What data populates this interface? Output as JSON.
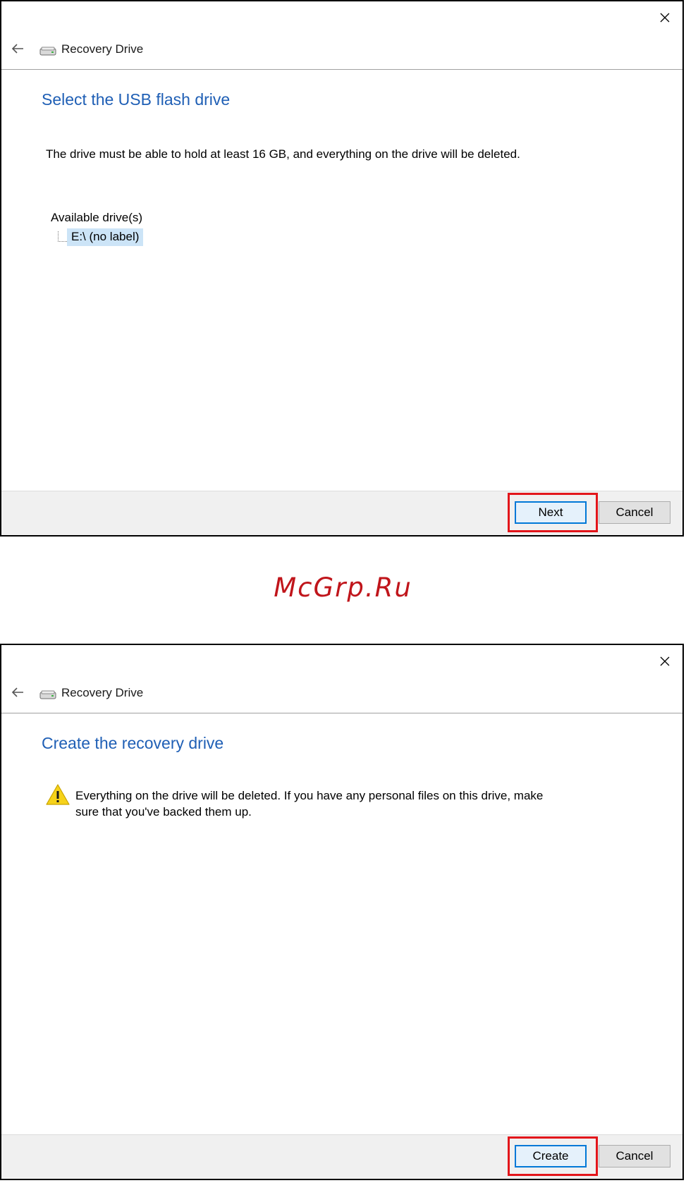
{
  "watermark": "McGrp.Ru",
  "colors": {
    "heading": "#1f5fb5",
    "highlight": "#e3151a",
    "selection": "#cce4f7",
    "primary_border": "#0078d7",
    "watermark": "#c0151b"
  },
  "icons": {
    "close": "close-icon",
    "back": "back-arrow-icon",
    "app": "drive-icon",
    "warning": "warning-icon"
  },
  "window1": {
    "title": "Recovery Drive",
    "heading": "Select the USB flash drive",
    "instruction": "The drive must be able to hold at least 16 GB, and everything on the drive will be deleted.",
    "drives_label": "Available drive(s)",
    "drives": [
      {
        "label": "E:\\ (no label)",
        "selected": true
      }
    ],
    "buttons": {
      "primary": "Next",
      "cancel": "Cancel"
    }
  },
  "window2": {
    "title": "Recovery Drive",
    "heading": "Create the recovery drive",
    "warning_line1": "Everything on the drive will be deleted. If you have any personal files on this drive, make",
    "warning_line2": "sure that you've backed them up.",
    "buttons": {
      "primary": "Create",
      "cancel": "Cancel"
    }
  }
}
